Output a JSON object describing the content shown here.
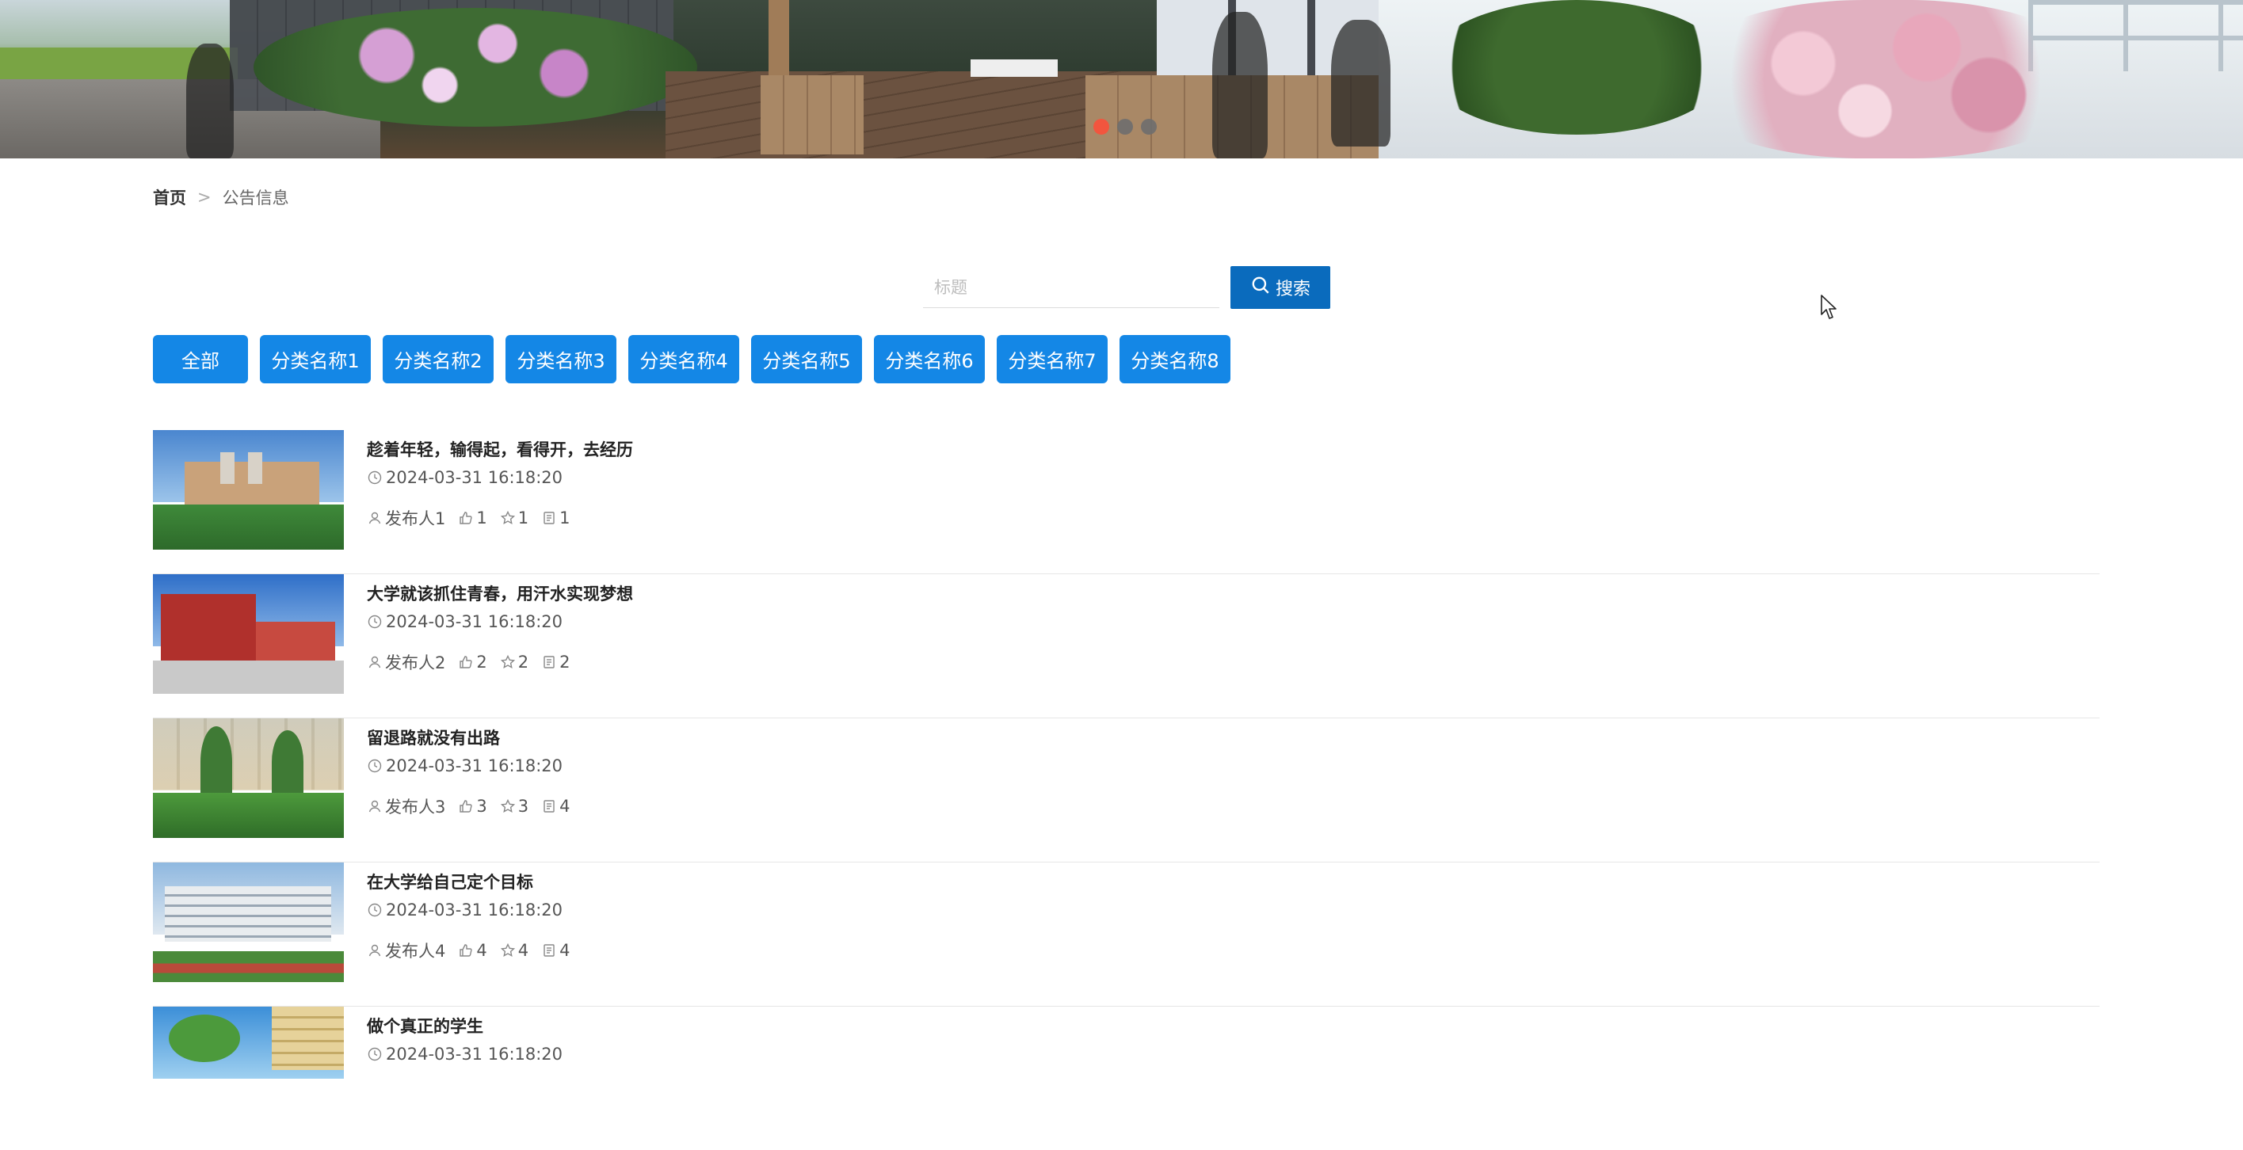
{
  "breadcrumb": {
    "home": "首页",
    "separator": ">",
    "current": "公告信息"
  },
  "search": {
    "placeholder": "标题",
    "value": "",
    "button_label": "搜索"
  },
  "categories": [
    "全部",
    "分类名称1",
    "分类名称2",
    "分类名称3",
    "分类名称4",
    "分类名称5",
    "分类名称6",
    "分类名称7",
    "分类名称8"
  ],
  "banner": {
    "slide_count": 3,
    "active_slide": 1
  },
  "colors": {
    "primary": "#1487e6",
    "search_button": "#0a6bbd",
    "active_dot": "#f2553e"
  },
  "icons": [
    "search-icon",
    "clock-icon",
    "user-icon",
    "thumbs-up-icon",
    "star-icon",
    "comment-icon",
    "mouse-cursor-icon"
  ],
  "notices": [
    {
      "title": "趁着年轻，输得起，看得开，去经历",
      "time": "2024-03-31 16:18:20",
      "author": "发布人1",
      "likes": "1",
      "favorites": "1",
      "comments": "1"
    },
    {
      "title": "大学就该抓住青春，用汗水实现梦想",
      "time": "2024-03-31 16:18:20",
      "author": "发布人2",
      "likes": "2",
      "favorites": "2",
      "comments": "2"
    },
    {
      "title": "留退路就没有出路",
      "time": "2024-03-31 16:18:20",
      "author": "发布人3",
      "likes": "3",
      "favorites": "3",
      "comments": "4"
    },
    {
      "title": "在大学给自己定个目标",
      "time": "2024-03-31 16:18:20",
      "author": "发布人4",
      "likes": "4",
      "favorites": "4",
      "comments": "4"
    },
    {
      "title": "做个真正的学生",
      "time": "2024-03-31 16:18:20",
      "author": "",
      "likes": "",
      "favorites": "",
      "comments": ""
    }
  ]
}
